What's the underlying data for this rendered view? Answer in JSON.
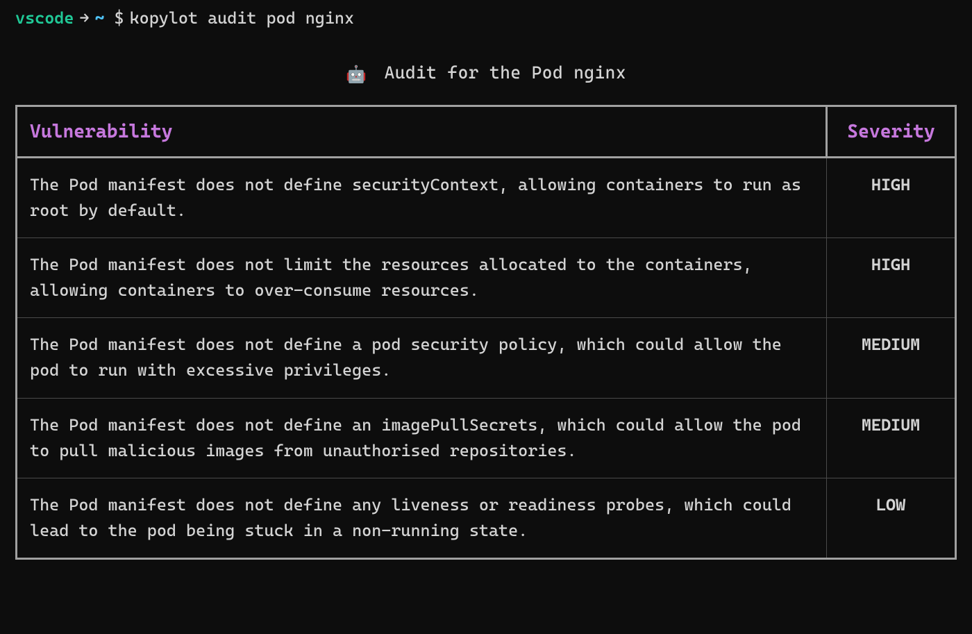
{
  "prompt": {
    "user": "vscode",
    "arrow": "→",
    "tilde": "~",
    "dollar": "$",
    "command": "kopylot audit pod nginx"
  },
  "audit": {
    "robot_emoji": "🤖",
    "title": "Audit for the Pod nginx",
    "columns": {
      "vulnerability": "Vulnerability",
      "severity": "Severity"
    },
    "rows": [
      {
        "vulnerability": "The Pod manifest does not define securityContext, allowing containers to run as root by default.",
        "severity": "HIGH",
        "severity_level": "high"
      },
      {
        "vulnerability": "The Pod manifest does not limit the resources allocated to the containers, allowing containers to over-consume resources.",
        "severity": "HIGH",
        "severity_level": "high"
      },
      {
        "vulnerability": "The Pod manifest does not define a pod security policy, which could allow the pod to run with excessive privileges.",
        "severity": "MEDIUM",
        "severity_level": "medium"
      },
      {
        "vulnerability": "The Pod manifest does not define an imagePullSecrets, which could allow the pod to pull malicious images from unauthorised repositories.",
        "severity": "MEDIUM",
        "severity_level": "medium"
      },
      {
        "vulnerability": "The Pod manifest does not define any liveness or readiness probes, which could lead to the pod being stuck in a non-running state.",
        "severity": "LOW",
        "severity_level": "low"
      }
    ]
  },
  "colors": {
    "high": "#ff8c00",
    "medium": "#ffeb3b",
    "low": "#26d9a3",
    "header": "#c678dd"
  }
}
